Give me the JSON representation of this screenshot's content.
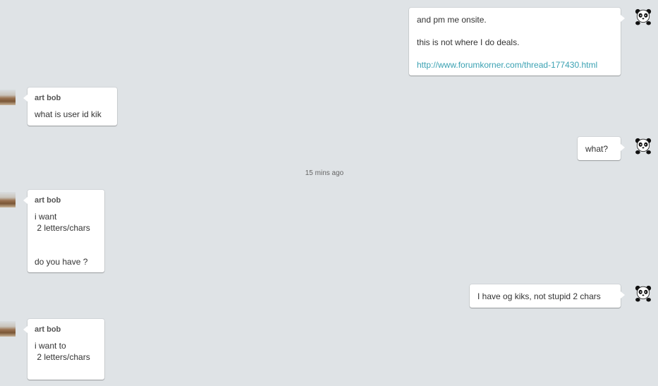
{
  "messages": [
    {
      "sender": "",
      "direction": "outgoing",
      "lines": [
        "and pm me onsite.",
        "this is not where I do deals."
      ],
      "link": "http://www.forumkorner.com/thread-177430.html"
    },
    {
      "sender": "art bob",
      "direction": "incoming",
      "lines": [
        "what is user id kik"
      ]
    },
    {
      "sender": "",
      "direction": "outgoing",
      "lines": [
        "what?"
      ]
    },
    {
      "sender": "art bob",
      "direction": "incoming",
      "lines": [
        "i want",
        " 2 letters/chars",
        "",
        "do you have ?"
      ]
    },
    {
      "sender": "",
      "direction": "outgoing",
      "lines": [
        "I have og kiks, not stupid 2 chars"
      ]
    },
    {
      "sender": "art bob",
      "direction": "incoming",
      "lines": [
        "i want to",
        " 2 letters/chars"
      ]
    }
  ],
  "timestamp": "15 mins ago",
  "avatars": {
    "self": "panda-avatar",
    "other": "art-bob-photo-avatar"
  }
}
